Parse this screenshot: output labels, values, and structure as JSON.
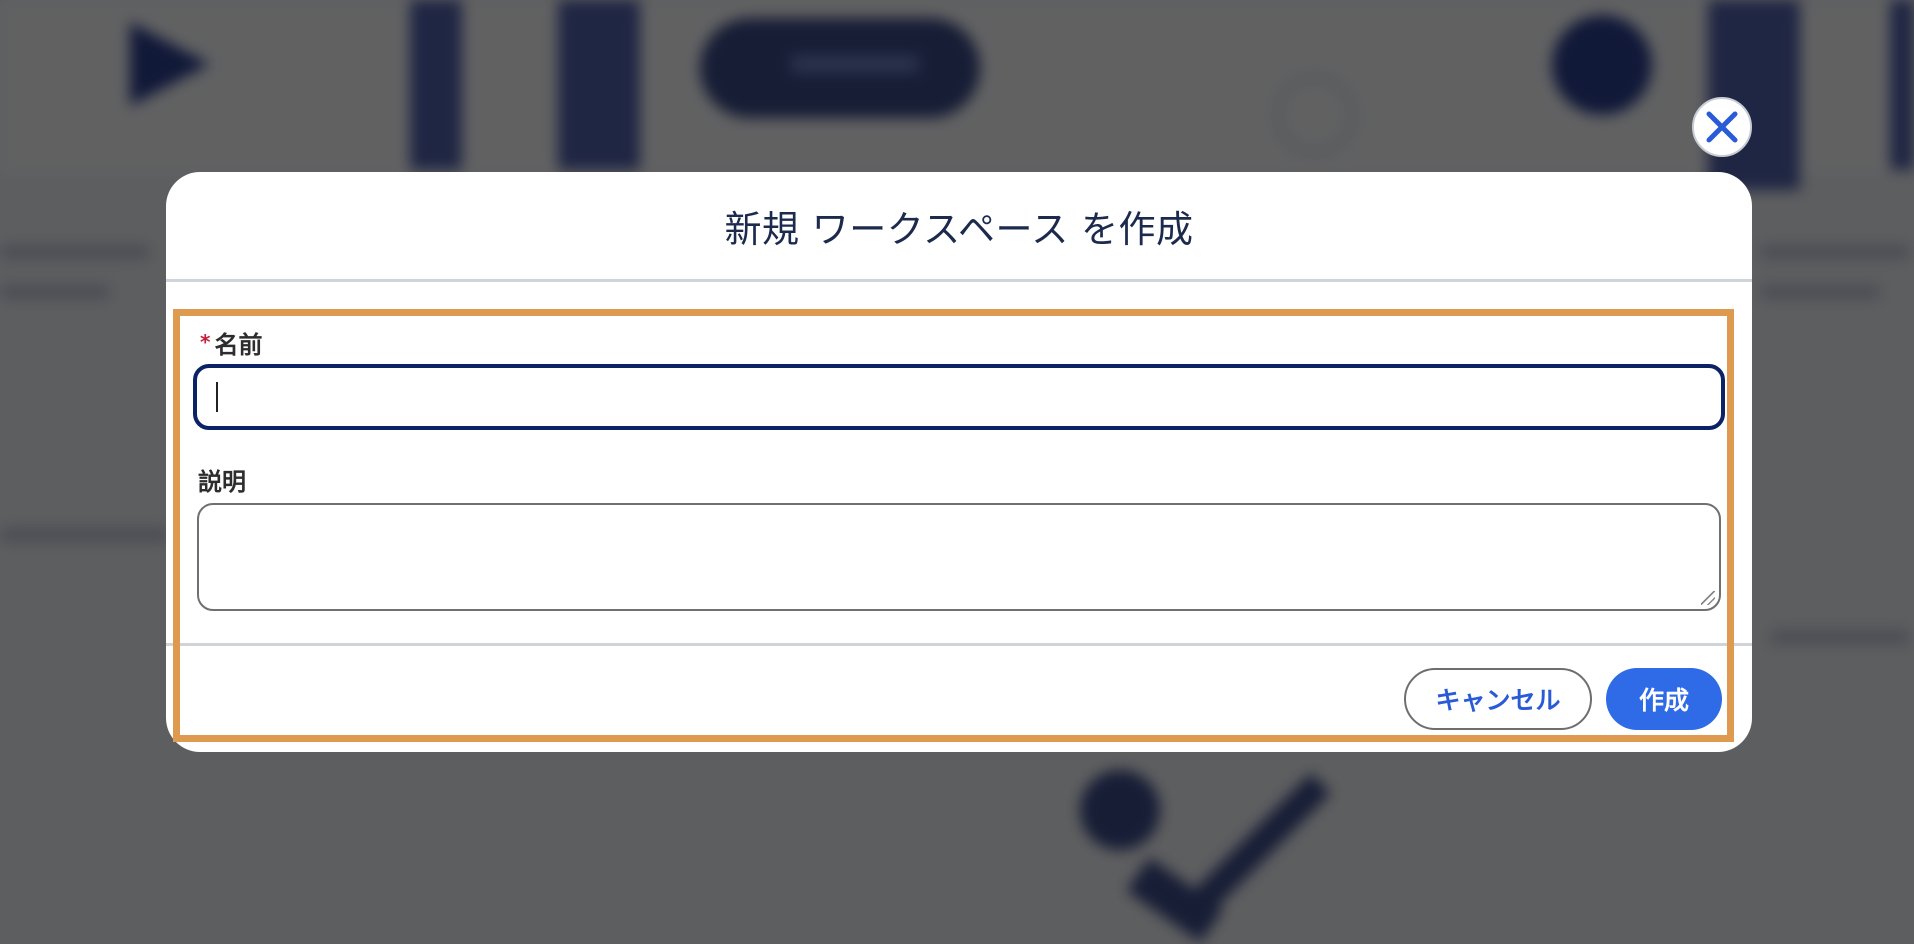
{
  "modal": {
    "title": "新規 ワークスペース を作成",
    "close_label": "close",
    "fields": {
      "name": {
        "required_marker": "*",
        "label": "名前",
        "value": "",
        "placeholder": ""
      },
      "description": {
        "label": "説明",
        "value": "",
        "placeholder": ""
      }
    },
    "buttons": {
      "cancel": "キャンセル",
      "create": "作成"
    }
  },
  "colors": {
    "accent": "#2f6be6",
    "focus_border": "#0b2266",
    "required": "#c41e3a",
    "highlight": "#de9a4f",
    "title_text": "#1c2a4d"
  },
  "icons": {
    "close": "close-icon",
    "resize": "resize-grip-icon"
  }
}
